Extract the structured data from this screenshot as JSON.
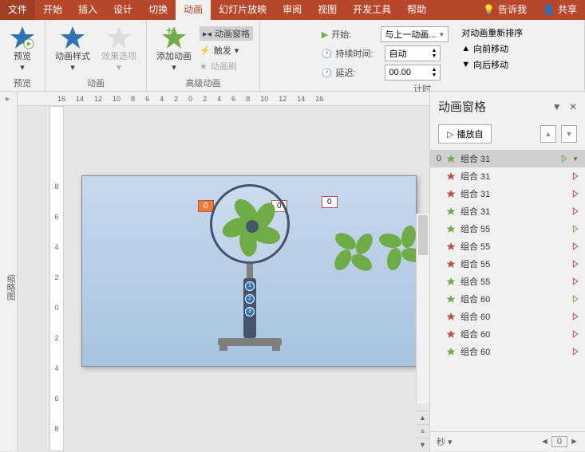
{
  "tabs": {
    "file": "文件",
    "home": "开始",
    "insert": "插入",
    "design": "设计",
    "transitions": "切换",
    "animations": "动画",
    "slideshow": "幻灯片放映",
    "review": "审阅",
    "view": "视图",
    "developer": "开发工具",
    "help": "帮助",
    "tellme": "告诉我",
    "share": "共享"
  },
  "ribbon": {
    "preview": "预览",
    "preview_group": "预览",
    "anim_style": "动画样式",
    "effect_options": "效果选项",
    "anim_group": "动画",
    "add_anim": "添加动画",
    "anim_pane": "动画窗格",
    "trigger": "触发",
    "anim_painter": "动画刷",
    "adv_anim_group": "高级动画",
    "start": "开始:",
    "start_value": "与上一动画...",
    "duration": "持续时间:",
    "duration_value": "自动",
    "delay": "延迟:",
    "delay_value": "00.00",
    "timing_group": "计时",
    "reorder": "对动画重新排序",
    "move_earlier": "向前移动",
    "move_later": "向后移动"
  },
  "ruler_h": [
    "16",
    "14",
    "12",
    "10",
    "8",
    "6",
    "4",
    "2",
    "0",
    "2",
    "4",
    "6",
    "8",
    "10",
    "12",
    "14",
    "16"
  ],
  "ruler_v": [
    "8",
    "6",
    "4",
    "2",
    "0",
    "2",
    "4",
    "6",
    "8"
  ],
  "outline": "缩略图",
  "slide": {
    "label0a": "0",
    "label0b": "0",
    "label0c": "0",
    "btn1": "1",
    "btn2": "2",
    "btn3": "3"
  },
  "pane": {
    "title": "动画窗格",
    "play": "播放自",
    "seconds": "秒",
    "zero": "0",
    "items": [
      {
        "idx": "0",
        "name": "组合 31",
        "color": "#70ad47",
        "marker": "#70ad47",
        "selected": true
      },
      {
        "idx": "",
        "name": "组合 31",
        "color": "#c0504d",
        "marker": "#c0504d"
      },
      {
        "idx": "",
        "name": "组合 31",
        "color": "#c0504d",
        "marker": "#c0504d"
      },
      {
        "idx": "",
        "name": "组合 31",
        "color": "#70ad47",
        "marker": "#c0504d"
      },
      {
        "idx": "",
        "name": "组合 55",
        "color": "#70ad47",
        "marker": "#70ad47"
      },
      {
        "idx": "",
        "name": "组合 55",
        "color": "#c0504d",
        "marker": "#c0504d"
      },
      {
        "idx": "",
        "name": "组合 55",
        "color": "#c0504d",
        "marker": "#c0504d"
      },
      {
        "idx": "",
        "name": "组合 55",
        "color": "#70ad47",
        "marker": "#c0504d"
      },
      {
        "idx": "",
        "name": "组合 60",
        "color": "#70ad47",
        "marker": "#70ad47"
      },
      {
        "idx": "",
        "name": "组合 60",
        "color": "#c0504d",
        "marker": "#c0504d"
      },
      {
        "idx": "",
        "name": "组合 60",
        "color": "#c0504d",
        "marker": "#c0504d"
      },
      {
        "idx": "",
        "name": "组合 60",
        "color": "#70ad47",
        "marker": "#c0504d"
      }
    ]
  }
}
